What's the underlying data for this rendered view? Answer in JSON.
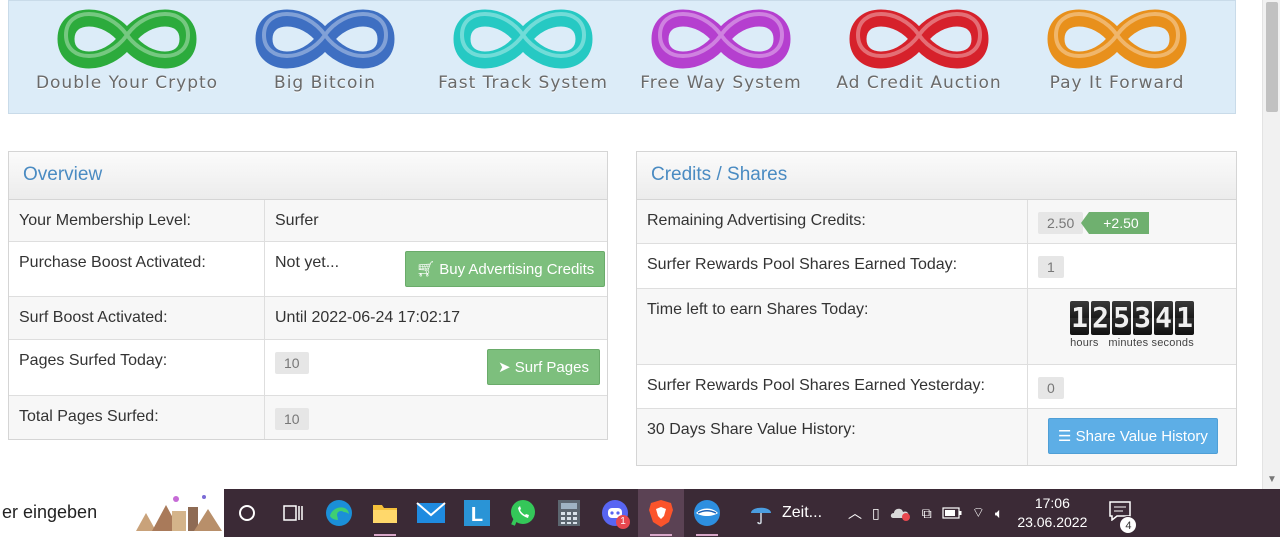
{
  "banner": {
    "items": [
      {
        "label": "Double Your Crypto",
        "color": "#2cab3c"
      },
      {
        "label": "Big Bitcoin",
        "color": "#3e6fc2"
      },
      {
        "label": "Fast Track System",
        "color": "#26c9c3"
      },
      {
        "label": "Free Way System",
        "color": "#b53fcf"
      },
      {
        "label": "Ad Credit Auction",
        "color": "#d6212b"
      },
      {
        "label": "Pay It Forward",
        "color": "#e8901c"
      }
    ]
  },
  "overview": {
    "title": "Overview",
    "rows": [
      {
        "label": "Your Membership Level:",
        "value": "Surfer"
      },
      {
        "label": "Purchase Boost Activated:",
        "value": "Not yet...",
        "button": "Buy Advertising Credits"
      },
      {
        "label": "Surf Boost Activated:",
        "value": "Until 2022-06-24 17:02:17"
      },
      {
        "label": "Pages Surfed Today:",
        "value": "10",
        "button": "Surf Pages"
      },
      {
        "label": "Total Pages Surfed:",
        "value": "10"
      }
    ]
  },
  "credits": {
    "title": "Credits / Shares",
    "rows": [
      {
        "label": "Remaining Advertising Credits:",
        "value": "2.50",
        "tag": "+2.50"
      },
      {
        "label": "Surfer Rewards Pool Shares Earned Today:",
        "value": "1"
      },
      {
        "label": "Time left to earn Shares Today:",
        "digits": [
          "1",
          "2",
          "5",
          "3",
          "4",
          "1"
        ],
        "units": "hours   minutes seconds"
      },
      {
        "label": "Surfer Rewards Pool Shares Earned Yesterday:",
        "value": "0"
      },
      {
        "label": "30 Days Share Value History:",
        "button": "Share Value History"
      }
    ]
  },
  "taskbar": {
    "search_text": "er eingeben",
    "weather_text": "Zeit...",
    "discord_badge": "1",
    "time": "17:06",
    "date": "23.06.2022",
    "notifications": "4"
  },
  "colors": {
    "accent": "#4a8bc2",
    "green": "#7dbf7d",
    "blue": "#5daee6",
    "taskbar": "#3b2a36"
  }
}
